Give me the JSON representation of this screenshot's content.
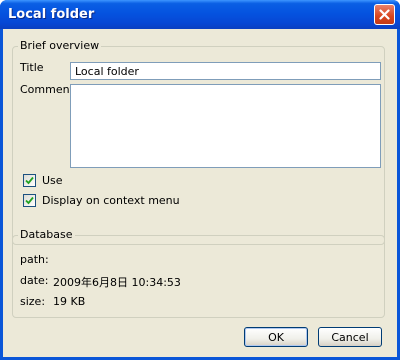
{
  "window": {
    "title": "Local folder"
  },
  "overview": {
    "legend": "Brief overview",
    "title_label": "Title",
    "title_value": "Local folder",
    "comment_label": "Comment",
    "comment_value": "",
    "use_label": "Use",
    "use_checked": true,
    "context_menu_label": "Display on context menu",
    "context_menu_checked": true
  },
  "database": {
    "legend": "Database",
    "path_label": "path:",
    "path_value": "",
    "date_label": "date:",
    "date_value": "2009年6月8日 10:34:53",
    "size_label": "size:",
    "size_value": "19 KB"
  },
  "buttons": {
    "ok": "OK",
    "cancel": "Cancel"
  },
  "colors": {
    "titlebar": "#0553e0",
    "client": "#ece9d8",
    "close": "#d9451d",
    "check": "#21a121"
  }
}
